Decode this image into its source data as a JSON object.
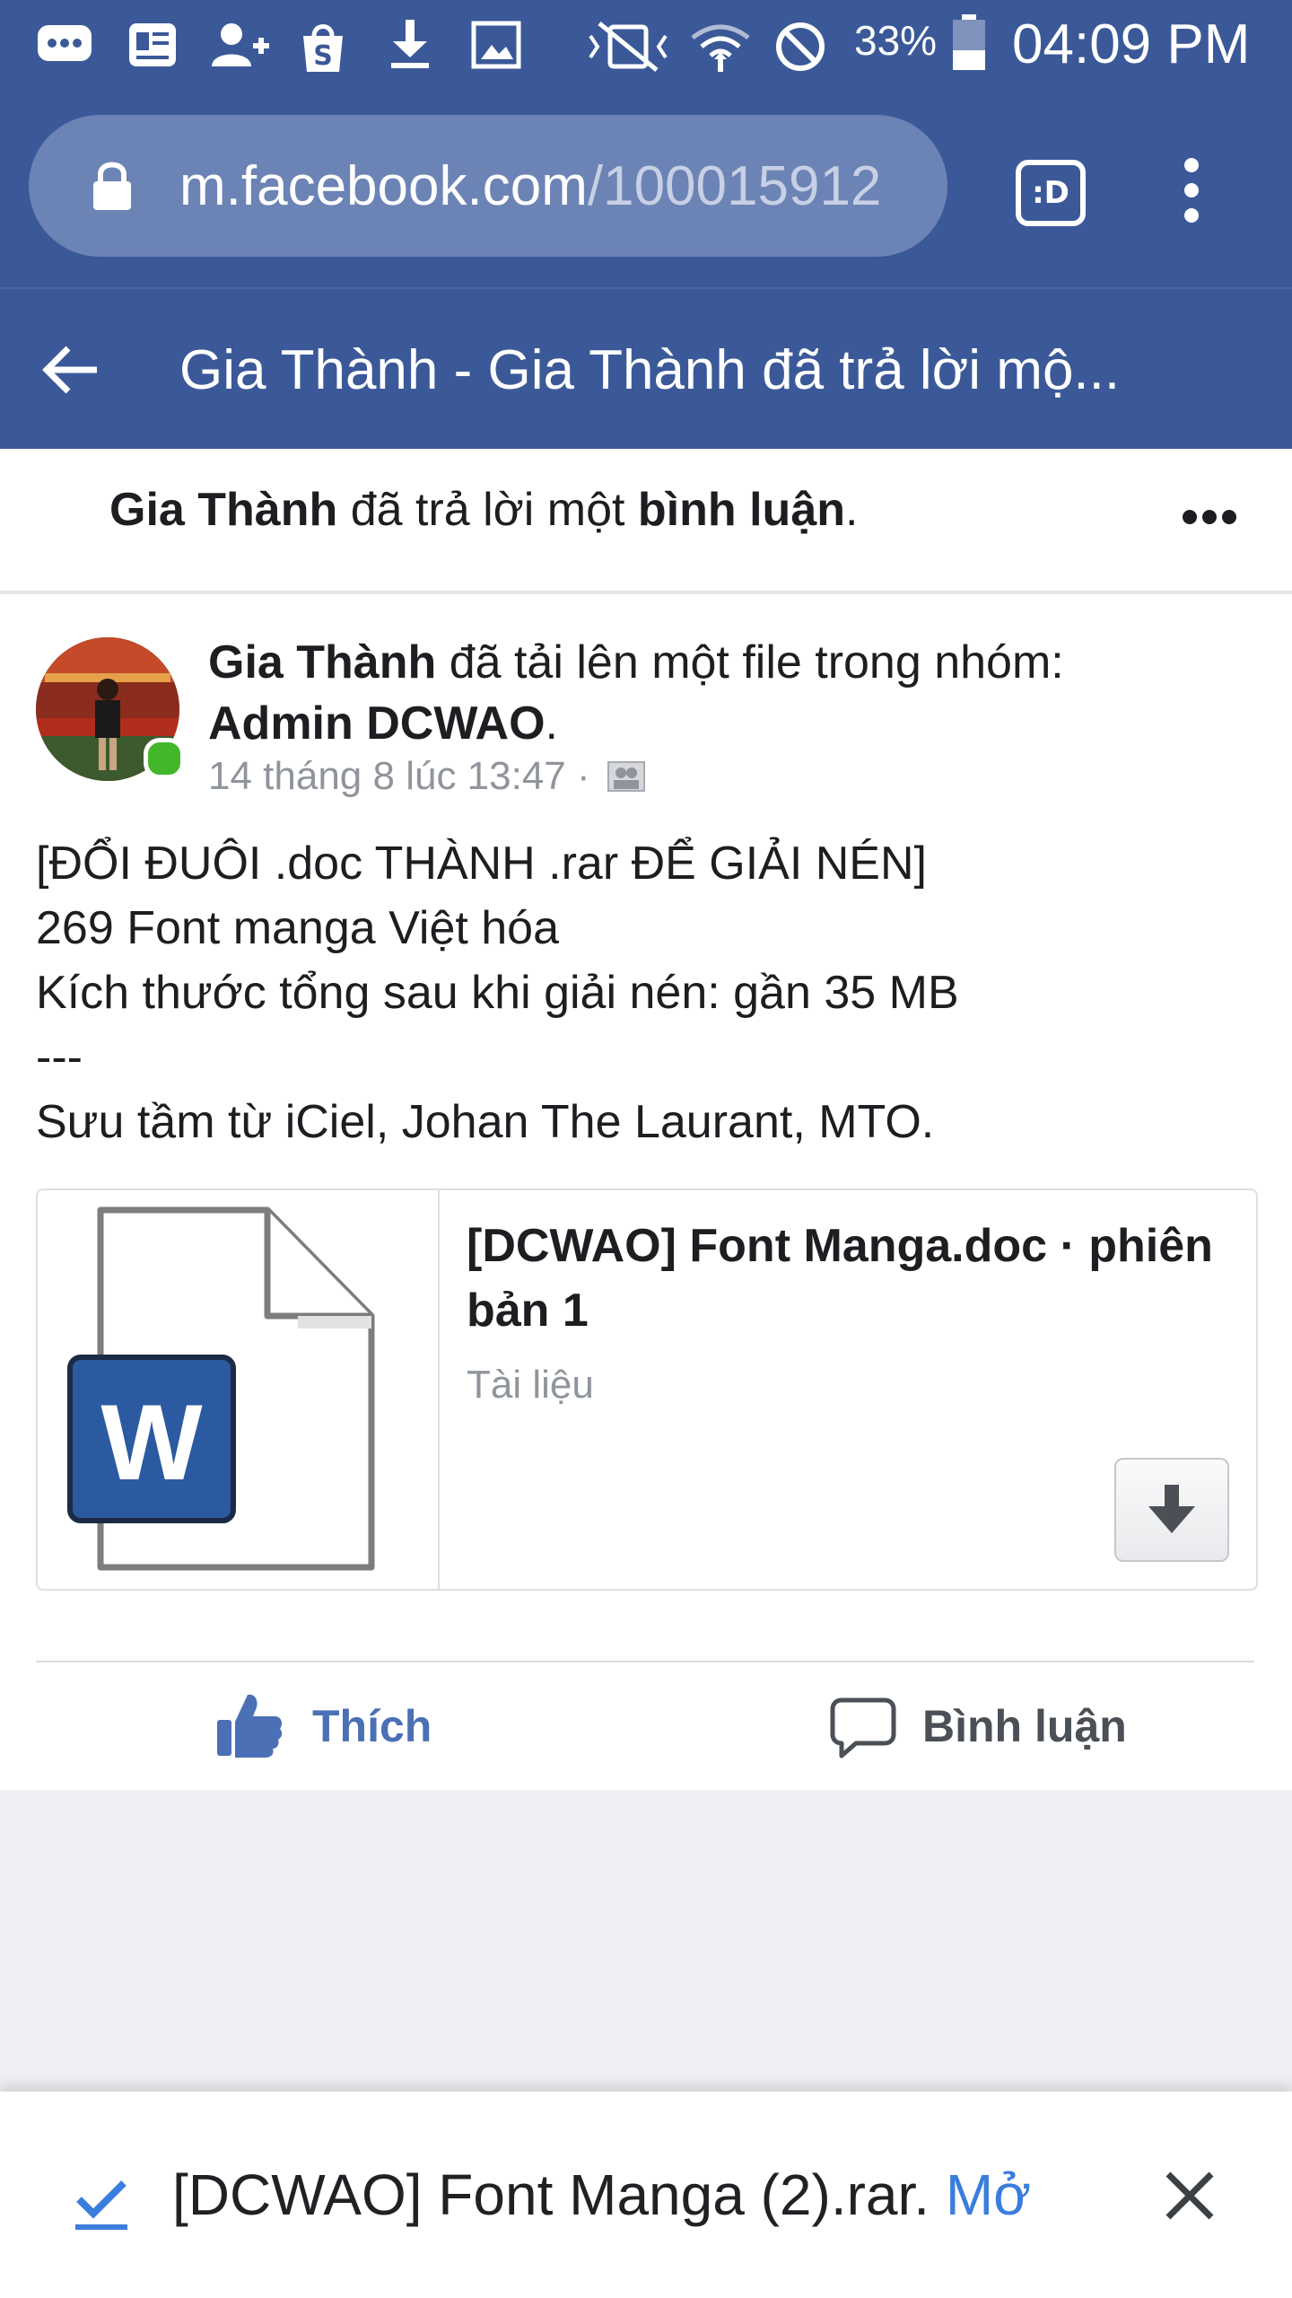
{
  "status_bar": {
    "battery": "33%",
    "time": "04:09 PM"
  },
  "browser": {
    "url_host": "m.facebook.com",
    "url_path": "/100015912",
    "tab_switcher_label": ":D"
  },
  "nav": {
    "title": "Gia Thành - Gia Thành đã trả lời mộ..."
  },
  "notification": {
    "actor": "Gia Thành",
    "action": " đã trả lời một ",
    "object": "bình luận",
    "end": "."
  },
  "post": {
    "author": "Gia Thành",
    "action": " đã tải lên một file trong nhóm:",
    "group": "Admin DCWAO",
    "group_end": ".",
    "timestamp": "14 tháng 8 lúc 13:47 ·",
    "lines": [
      "[ĐỔI ĐUÔI .doc THÀNH .rar ĐỂ GIẢI NÉN]",
      "269 Font manga Việt hóa",
      "Kích thước tổng sau khi giải nén: gần 35 MB",
      "---",
      "Sưu tầm từ iCiel, Johan The Laurant, MTO."
    ],
    "attachment": {
      "title": "[DCWAO] Font Manga.doc · phiên bản 1",
      "subtitle": "Tài liệu",
      "icon_letter": "W"
    },
    "like_label": "Thích",
    "comment_label": "Bình luận"
  },
  "download": {
    "filename": "[DCWAO] Font Manga (2).rar.",
    "open_label": "Mở"
  },
  "colors": {
    "fb_blue": "#3b5998",
    "like_blue": "#4b70b5",
    "link_blue": "#3b7ddd",
    "online_green": "#42b72a"
  }
}
